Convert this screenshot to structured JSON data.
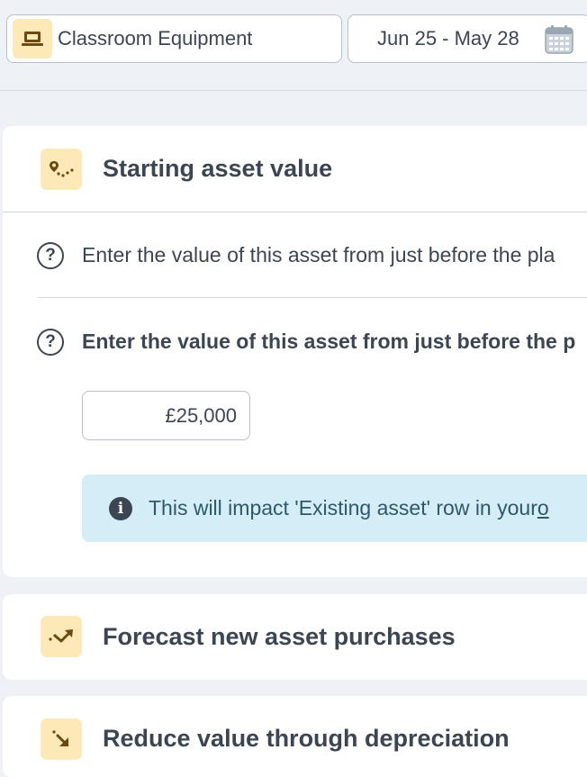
{
  "header": {
    "asset_selector": {
      "label": "Classroom Equipment",
      "icon": "laptop-icon"
    },
    "date_range": {
      "label": "Jun 25 - May 28",
      "icon": "calendar-icon"
    }
  },
  "sections": {
    "starting_value": {
      "title": "Starting asset value",
      "icon": "map-route-icon",
      "question_1": "Enter the value of this asset from just before the pla",
      "question_2": "Enter the value of this asset from just before the p",
      "input_value": "£25,000",
      "info_text": "This will impact 'Existing asset' row in your ",
      "info_link": "o"
    },
    "new_purchases": {
      "title": "Forecast new asset purchases",
      "icon": "trend-up-icon"
    },
    "depreciation": {
      "title": "Reduce value through depreciation",
      "icon": "arrow-down-right-icon"
    }
  },
  "colors": {
    "background": "#eef2f6",
    "icon_tile": "#fde9b8",
    "icon_accent": "#6b4a12",
    "text": "#3c4653",
    "info_banner": "#d4edf7"
  }
}
